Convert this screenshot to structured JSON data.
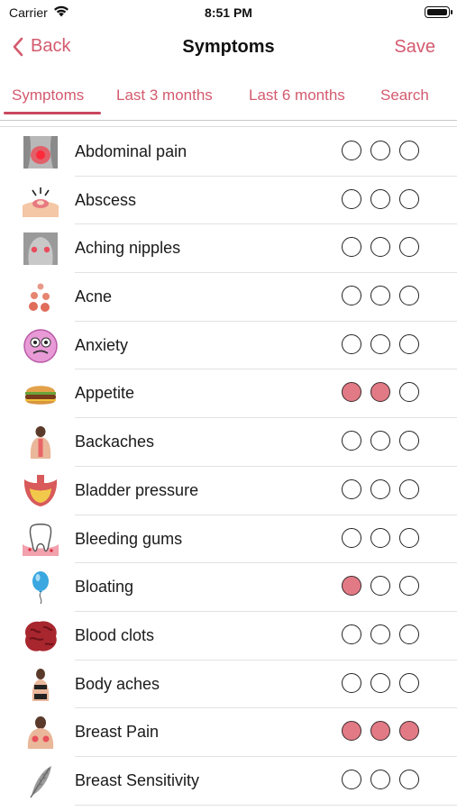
{
  "status": {
    "carrier": "Carrier",
    "time": "8:51 PM"
  },
  "nav": {
    "back_label": "Back",
    "title": "Symptoms",
    "save_label": "Save"
  },
  "tabs": [
    {
      "label": "Symptoms",
      "active": true
    },
    {
      "label": "Last 3 months",
      "active": false
    },
    {
      "label": "Last 6 months",
      "active": false
    },
    {
      "label": "Search",
      "active": false
    }
  ],
  "accent_color": "#d35a6e",
  "filled_color": "#e27a86",
  "symptoms": [
    {
      "label": "Abdominal pain",
      "icon": "abdomen-icon",
      "severity": 0
    },
    {
      "label": "Abscess",
      "icon": "abscess-icon",
      "severity": 0
    },
    {
      "label": "Aching nipples",
      "icon": "chest-icon",
      "severity": 0
    },
    {
      "label": "Acne",
      "icon": "acne-icon",
      "severity": 0
    },
    {
      "label": "Anxiety",
      "icon": "anxious-face-icon",
      "severity": 0
    },
    {
      "label": "Appetite",
      "icon": "burger-icon",
      "severity": 2
    },
    {
      "label": "Backaches",
      "icon": "back-icon",
      "severity": 0
    },
    {
      "label": "Bladder pressure",
      "icon": "bladder-icon",
      "severity": 0
    },
    {
      "label": "Bleeding gums",
      "icon": "tooth-icon",
      "severity": 0
    },
    {
      "label": "Bloating",
      "icon": "balloon-icon",
      "severity": 1
    },
    {
      "label": "Blood clots",
      "icon": "blood-clot-icon",
      "severity": 0
    },
    {
      "label": "Body aches",
      "icon": "body-icon",
      "severity": 0
    },
    {
      "label": "Breast Pain",
      "icon": "breast-icon",
      "severity": 3
    },
    {
      "label": "Breast Sensitivity",
      "icon": "feather-icon",
      "severity": 0
    }
  ]
}
